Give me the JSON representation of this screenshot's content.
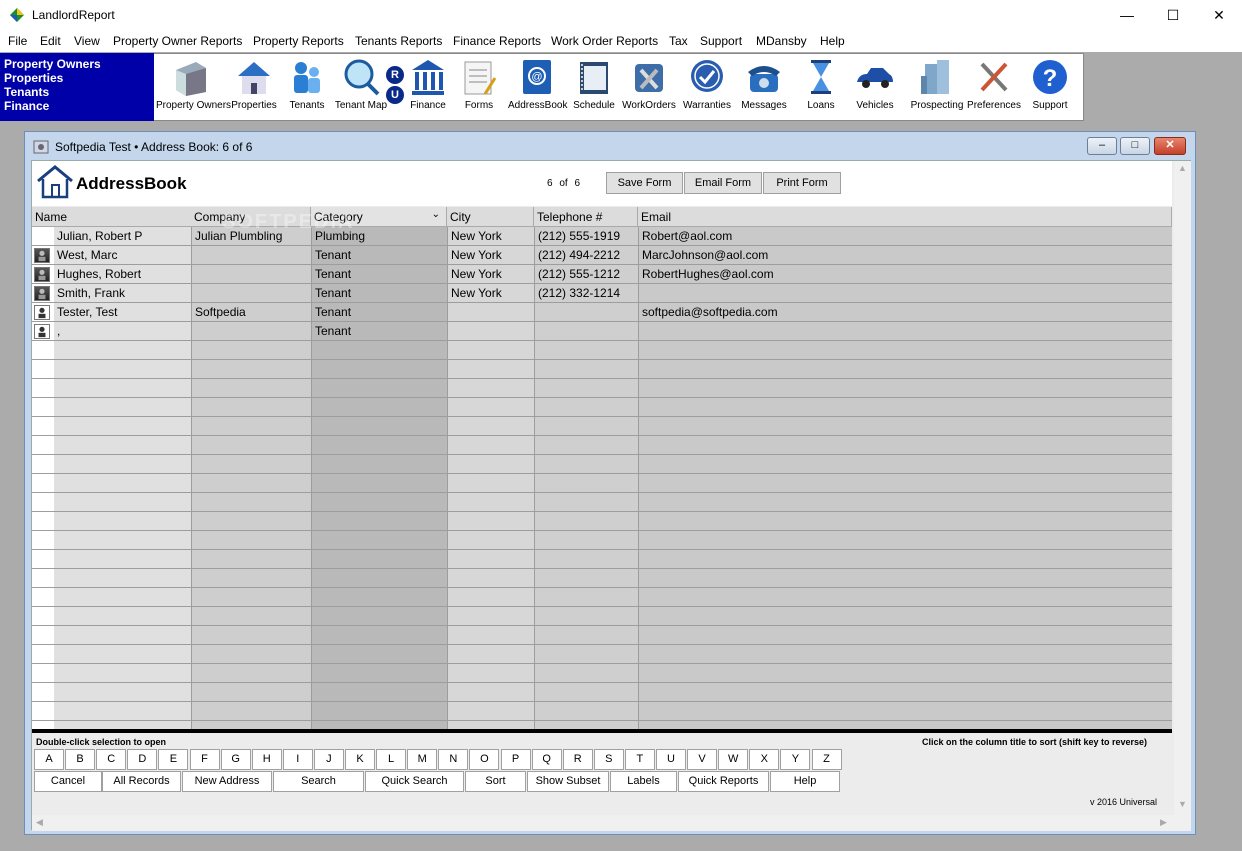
{
  "app": {
    "title": "LandlordReport"
  },
  "menu": [
    "File",
    "Edit",
    "View",
    "Property Owner Reports",
    "Property Reports",
    "Tenants Reports",
    "Finance Reports",
    "Work Order Reports",
    "Tax",
    "Support",
    "MDansby",
    "Help"
  ],
  "nav_panel": [
    "Property Owners",
    "Properties",
    "Tenants",
    "Finance"
  ],
  "toolbar": [
    {
      "label": "Property Owners",
      "icon": "building-icon"
    },
    {
      "label": "Properties",
      "icon": "house-icon"
    },
    {
      "label": "Tenants",
      "icon": "people-icon"
    },
    {
      "label": "Tenant Map",
      "icon": "magnifier-map-icon"
    },
    {
      "label": "R",
      "icon": "r-circle-icon"
    },
    {
      "label": "U",
      "icon": "u-circle-icon"
    },
    {
      "label": "Finance",
      "icon": "bank-icon"
    },
    {
      "label": "Forms",
      "icon": "forms-icon"
    },
    {
      "label": "AddressBook",
      "icon": "addressbook-icon"
    },
    {
      "label": "Schedule",
      "icon": "schedule-icon"
    },
    {
      "label": "WorkOrders",
      "icon": "tools-icon"
    },
    {
      "label": "Warranties",
      "icon": "warranty-badge-icon"
    },
    {
      "label": "Messages",
      "icon": "telephone-icon"
    },
    {
      "label": "Loans",
      "icon": "hourglass-icon"
    },
    {
      "label": "Vehicles",
      "icon": "car-icon"
    },
    {
      "label": "Prospecting",
      "icon": "skyscraper-icon"
    },
    {
      "label": "Preferences",
      "icon": "wrench-screwdriver-icon"
    },
    {
      "label": "Support",
      "icon": "question-icon"
    }
  ],
  "child_window": {
    "title": "Softpedia Test  •  Address Book: 6 of 6"
  },
  "form": {
    "title": "AddressBook",
    "counter_current": "6",
    "counter_of": "of",
    "counter_total": "6",
    "save_label": "Save Form",
    "email_label": "Email Form",
    "print_label": "Print Form"
  },
  "grid": {
    "columns": [
      "Name",
      "Company",
      "Category",
      "City",
      "Telephone #",
      "Email"
    ],
    "rows": [
      {
        "name": "Julian, Robert P",
        "company": "Julian Plumbling",
        "category": "Plumbing",
        "city": "New York",
        "phone": "(212) 555-1919",
        "email": "Robert@aol.com",
        "avatar": "none"
      },
      {
        "name": "West, Marc",
        "company": "",
        "category": "Tenant",
        "city": "New York",
        "phone": "(212) 494-2212",
        "email": "MarcJohnson@aol.com",
        "avatar": "photo"
      },
      {
        "name": "Hughes, Robert",
        "company": "",
        "category": "Tenant",
        "city": "New York",
        "phone": "(212) 555-1212",
        "email": "RobertHughes@aol.com",
        "avatar": "photo"
      },
      {
        "name": "Smith, Frank",
        "company": "",
        "category": "Tenant",
        "city": "New York",
        "phone": "(212) 332-1214",
        "email": "",
        "avatar": "photo"
      },
      {
        "name": "Tester, Test",
        "company": "Softpedia",
        "category": "Tenant",
        "city": "",
        "phone": "",
        "email": "softpedia@softpedia.com",
        "avatar": "silhouette"
      },
      {
        "name": ",",
        "company": "",
        "category": "Tenant",
        "city": "",
        "phone": "",
        "email": "",
        "avatar": "silhouette"
      }
    ],
    "hint_left": "Double-click selection to open",
    "hint_right": "Click on the column title to sort (shift key to reverse)"
  },
  "alphabet": [
    "A",
    "B",
    "C",
    "D",
    "E",
    "F",
    "G",
    "H",
    "I",
    "J",
    "K",
    "L",
    "M",
    "N",
    "O",
    "P",
    "Q",
    "R",
    "S",
    "T",
    "U",
    "V",
    "W",
    "X",
    "Y",
    "Z"
  ],
  "actions": [
    "Cancel",
    "All Records",
    "New Address",
    "Search",
    "Quick Search",
    "Sort",
    "Show Subset",
    "Labels",
    "Quick Reports",
    "Help"
  ],
  "version": "v 2016 Universal",
  "watermark": "SOFTPEDIA"
}
